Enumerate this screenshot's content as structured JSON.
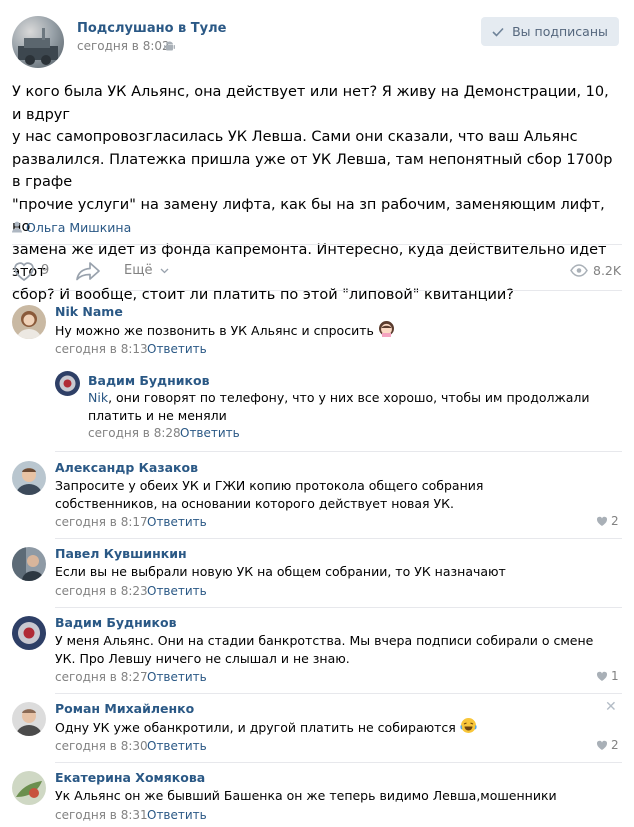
{
  "post": {
    "group_name": "Подслушано в Туле",
    "time": "сегодня в 8:02",
    "subscribed_label": "Вы подписаны",
    "text": "У кого была УК Альянс, она действует или нет? Я живу на Демонстрации, 10, и вдруг\nу нас самопровозгласилась УК Левша. Сами они сказали, что ваш Альянс\nразвалился. Платежка пришла уже от УК Левша, там непонятный сбор 1700р в графе\n\"прочие услуги\" на замену лифта, как бы на зп рабочим, заменяющим лифт, но\nзамена же идет из фонда капремонта. Интересно, куда действительно идет этот\nсбор? И вообще, стоит ли платить по этой \"липовой\" квитанции?",
    "author": "Ольга Мишкина",
    "likes": "9",
    "more_label": "Ещё",
    "views": "8.2K",
    "avatar_text": "Подслушано в Туле"
  },
  "comments": [
    {
      "author": "Nik Name",
      "text": "Ну можно же позвонить в УК Альянс и спросить",
      "time": "сегодня в 8:13",
      "reply": "Ответить"
    },
    {
      "author": "Вадим Будников",
      "mention": "Nik",
      "text": ", они говорят по телефону, что у них все хорошо, чтобы им продолжали платить и не меняли",
      "time": "сегодня в 8:28",
      "reply": "Ответить"
    },
    {
      "author": "Александр Казаков",
      "text": "Запросите у обеих УК и ГЖИ копию протокола общего собрания собственников, на основании которого действует новая УК.",
      "time": "сегодня в 8:17",
      "reply": "Ответить",
      "likes": "2"
    },
    {
      "author": "Павел Кувшинкин",
      "text": "Если вы не выбрали новую УК на общем собрании, то УК назначают",
      "time": "сегодня в 8:23",
      "reply": "Ответить"
    },
    {
      "author": "Вадим Будников",
      "text": "У меня Альянс. Они на стадии банкротства. Мы вчера подписи собирали о смене УК. Про Левшу ничего не слышал и не знаю.",
      "time": "сегодня в 8:27",
      "reply": "Ответить",
      "likes": "1"
    },
    {
      "author": "Роман Михайленко",
      "text": "Одну УК уже обанкротили, и другой платить не собираются",
      "time": "сегодня в 8:30",
      "reply": "Ответить",
      "likes": "2"
    },
    {
      "author": "Екатерина Хомякова",
      "text": "Ук Альянс он же бывший Башенка он же теперь видимо Левша,мошенники",
      "time": "сегодня в 8:31",
      "reply": "Ответить"
    }
  ],
  "colors": {
    "link": "#2a5885",
    "muted": "#828282",
    "button_bg": "#e5ebf1",
    "divider": "#e7e8ec"
  }
}
